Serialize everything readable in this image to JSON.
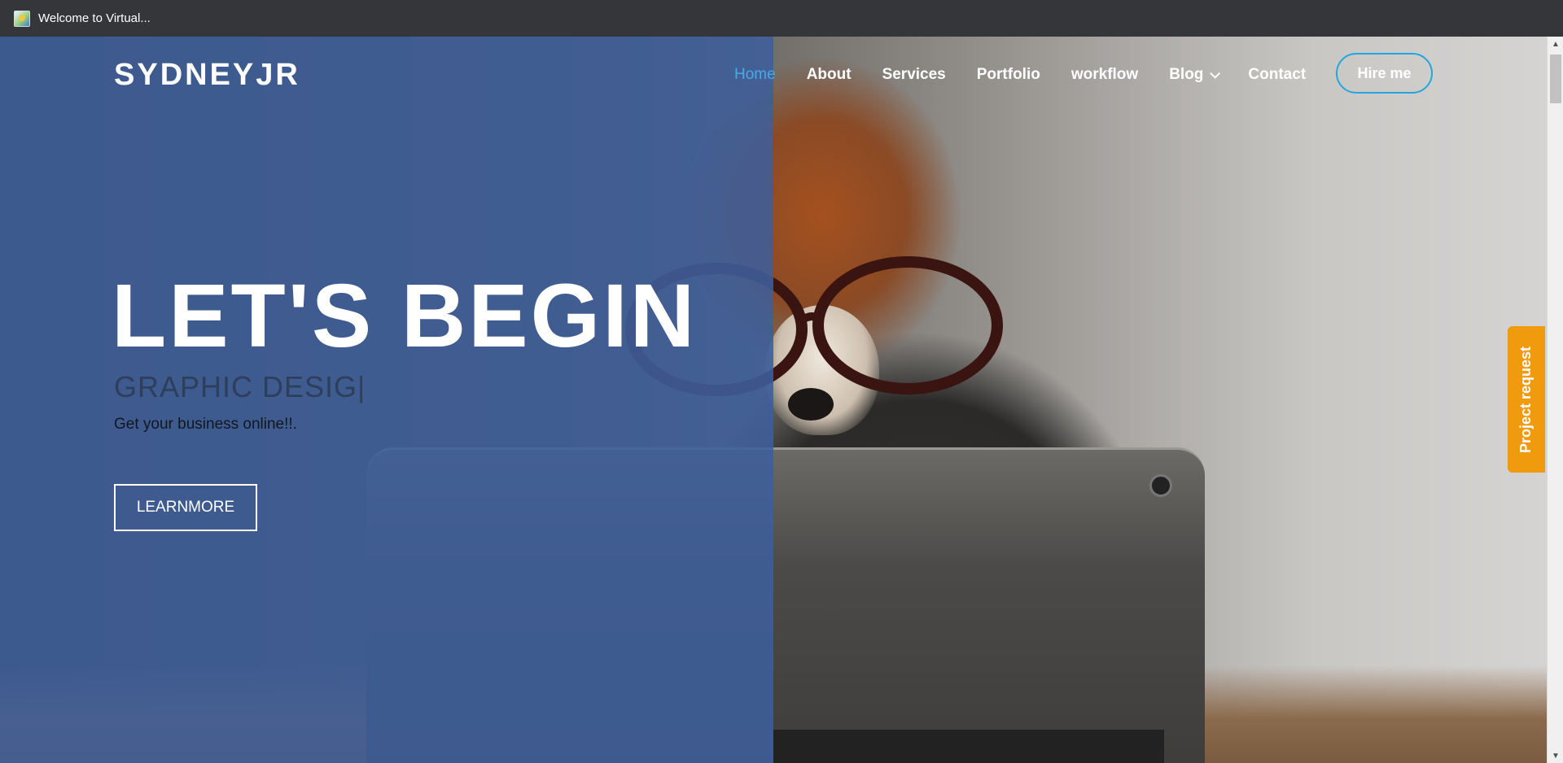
{
  "window": {
    "title": "Welcome to Virtual..."
  },
  "header": {
    "logo": "SYDNEYJR",
    "nav": [
      {
        "label": "Home",
        "active": true
      },
      {
        "label": "About"
      },
      {
        "label": "Services"
      },
      {
        "label": "Portfolio"
      },
      {
        "label": "workflow"
      },
      {
        "label": "Blog",
        "has_dropdown": true
      },
      {
        "label": "Contact"
      }
    ],
    "hire_button": "Hire me"
  },
  "hero": {
    "title": "LET'S BEGIN",
    "subtitle": "GRAPHIC DESIG|",
    "description": "Get your business online!!.",
    "cta": "LEARNMORE"
  },
  "side_tab": {
    "label": "Project request"
  },
  "icons": {
    "app": "app-favicon-icon",
    "dropdown": "chevron-down-icon",
    "scroll_up": "arrow-up-icon",
    "scroll_down": "arrow-down-icon"
  },
  "colors": {
    "overlay": "#3d5e9b",
    "nav_active": "#4aa8e6",
    "hire_border": "#22a6e0",
    "project_tab": "#f09a0e",
    "titlebar": "#35363a"
  }
}
